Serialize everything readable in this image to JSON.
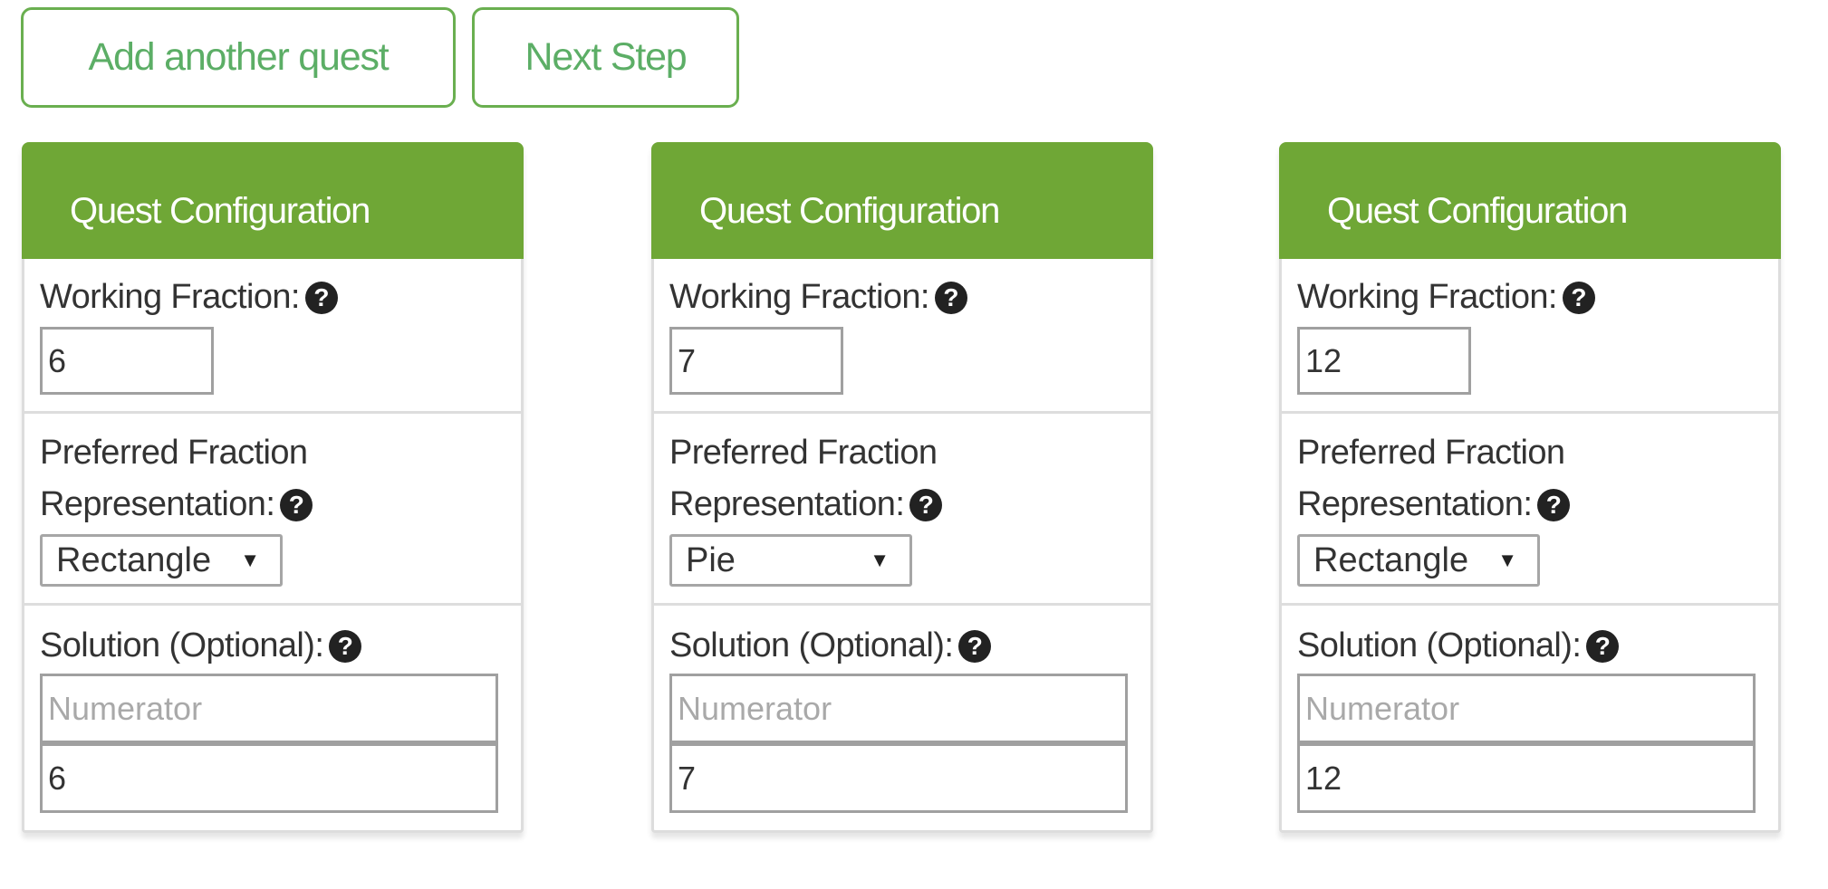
{
  "toolbar": {
    "add_quest_label": "Add another quest",
    "next_step_label": "Next Step"
  },
  "colors": {
    "header_green": "#6fa736",
    "button_green": "#5cae66",
    "help_icon": "#222222"
  },
  "icons": {
    "help": "question-circle-icon",
    "help_glyph": "?",
    "dropdown": "caret-down-icon",
    "dropdown_glyph": "▼"
  },
  "quests": [
    {
      "title": "Quest Configuration",
      "working_fraction_label": "Working Fraction:",
      "working_fraction_value": "6",
      "representation_label": "Preferred Fraction Representation:",
      "representation_value": "Rectangle",
      "solution_label": "Solution (Optional):",
      "numerator_placeholder": "Numerator",
      "numerator_value": "",
      "denominator_value": "6"
    },
    {
      "title": "Quest Configuration",
      "working_fraction_label": "Working Fraction:",
      "working_fraction_value": "7",
      "representation_label": "Preferred Fraction Representation:",
      "representation_value": "Pie",
      "solution_label": "Solution (Optional):",
      "numerator_placeholder": "Numerator",
      "numerator_value": "",
      "denominator_value": "7"
    },
    {
      "title": "Quest Configuration",
      "working_fraction_label": "Working Fraction:",
      "working_fraction_value": "12",
      "representation_label": "Preferred Fraction Representation:",
      "representation_value": "Rectangle",
      "solution_label": "Solution (Optional):",
      "numerator_placeholder": "Numerator",
      "numerator_value": "",
      "denominator_value": "12"
    }
  ]
}
